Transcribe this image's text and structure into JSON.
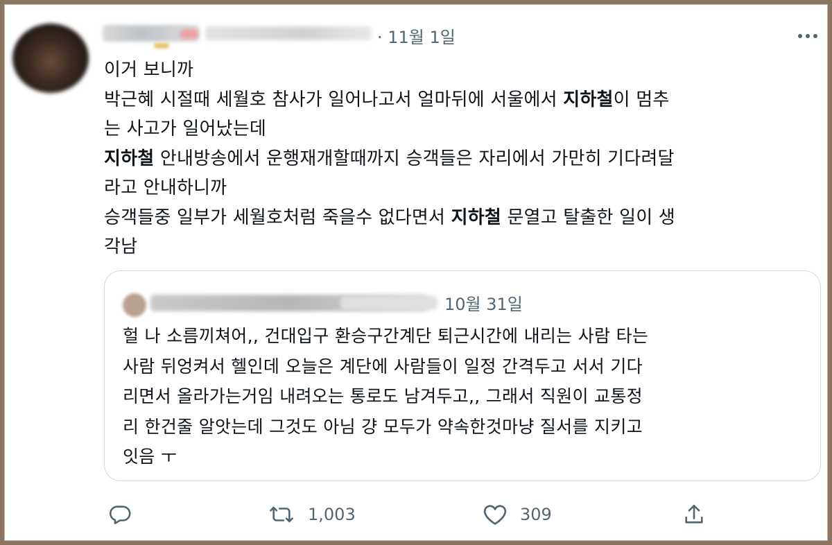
{
  "tweet": {
    "date": "· 11월 1일",
    "text_segments": [
      {
        "text": "이거 보니까\n박근혜 시절때 세월호 참사가 일어나고서 얼마뒤에 서울에서 ",
        "bold": false
      },
      {
        "text": "지하철",
        "bold": true
      },
      {
        "text": "이 멈추\n는 사고가 일어났는데\n",
        "bold": false
      },
      {
        "text": "지하철",
        "bold": true
      },
      {
        "text": " 안내방송에서 운행재개할때까지 승객들은 자리에서 가만히 기다려달\n라고 안내하니까\n승객들중 일부가 세월호처럼 죽을수 없다면서 ",
        "bold": false
      },
      {
        "text": "지하철",
        "bold": true
      },
      {
        "text": " 문열고 탈출한 일이 생\n각남",
        "bold": false
      }
    ]
  },
  "quoted_tweet": {
    "date": "10월 31일",
    "text": "헐 나 소름끼쳐어,, 건대입구 환승구간계단 퇴근시간에 내리는 사람 타는\n사람 뒤엉켜서 헬인데 오늘은 계단에 사람들이 일정 간격두고 서서 기다\n리면서 올라가는거임 내려오는 통로도 남겨두고,, 그래서 직원이 교통정\n리 한건줄 알앗는데 그것도 아님 걍 모두가 약속한것마냥 질서를 지키고\n잇음 ㅜ"
  },
  "actions": {
    "reply_icon": "reply-icon",
    "retweet_icon": "retweet-icon",
    "retweet_count": "1,003",
    "like_icon": "heart-icon",
    "like_count": "309",
    "share_icon": "share-icon"
  },
  "colors": {
    "text": "#0f1419",
    "secondary": "#536471",
    "border": "#cfd9de",
    "frame": "#8a7460"
  }
}
